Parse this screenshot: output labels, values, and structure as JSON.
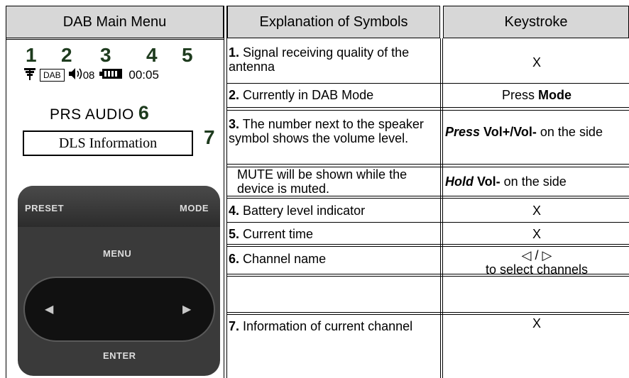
{
  "headers": {
    "col1": "DAB Main Menu",
    "col2": "Explanation of Symbols",
    "col3": "Keystroke"
  },
  "panel": {
    "digits": [
      "1",
      "2",
      "3",
      "4",
      "5"
    ],
    "dab_label": "DAB",
    "volume_text": "08",
    "time": "00:05",
    "station": "PRS AUDIO",
    "digit6": "6",
    "dls": "DLS Information",
    "digit7": "7",
    "device": {
      "preset": "PRESET",
      "mode": "MODE",
      "menu": "MENU",
      "enter": "ENTER"
    },
    "icons": [
      "antenna-icon",
      "speaker-icon",
      "battery-icon",
      "left-arrow-icon",
      "right-arrow-icon"
    ]
  },
  "rows": [
    {
      "num": "1.",
      "text": "Signal receiving quality of the antenna",
      "key": "X"
    },
    {
      "num": "2.",
      "text": "Currently in DAB Mode",
      "key_prefix": "Press ",
      "key_bold": "Mode"
    },
    {
      "num": "3.",
      "text": "The number next to the speaker symbol shows the volume level.",
      "key_italic": "Press",
      "key_bold": " Vol+/Vol-",
      "key_suffix": " on the side"
    },
    {
      "num": "",
      "text": "MUTE will be shown while the device is muted.",
      "key_italic": "Hold",
      "key_bold": " Vol-",
      "key_suffix": " on the side"
    },
    {
      "num": "4.",
      "text": "Battery level indicator",
      "key": "X"
    },
    {
      "num": "5.",
      "text": "Current time",
      "key": "X"
    },
    {
      "num": "6.",
      "text": "Channel name",
      "key_line1": "◁ / ▷",
      "key_line2": "to select channels"
    },
    {
      "num": "7.",
      "text": "Information of current channel",
      "key": "X"
    }
  ]
}
